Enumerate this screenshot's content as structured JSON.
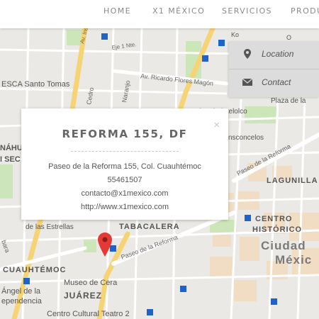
{
  "nav": {
    "items": [
      "HOME",
      "X1 MÉXICO",
      "SERVICIOS",
      "PRODU"
    ]
  },
  "side_panel": {
    "location_label": "Location",
    "contact_label": "Contact",
    "icons": [
      "map-marker-icon",
      "envelope-icon"
    ]
  },
  "popup": {
    "title": "REFORMA 155, DF",
    "close_symbol": "×",
    "address": "Paseo de la Reforma 155, Col. Cuauhtémoc",
    "phone": "55461507",
    "email": "contacto@x1mexico.com",
    "website": "http://www.x1mexico.com"
  },
  "map": {
    "marker_color": "#e53935",
    "labels": {
      "esca": "ESCA Santo Tomas",
      "av_ricardo": "Av. Ricardo Flores Magón",
      "cc_tlatelolco": "Centro Cultural Tlatelolco",
      "plaza": "Plaza de la",
      "buenavista": "nsconcelos",
      "paseo_reforma_ne": "Paseo de la Reforma",
      "lagunilla": "LAGUNILLA",
      "nahu": "NÁHU",
      "sec": "I SEC",
      "estrellas": "de las Estrellas",
      "tabacalera": "TABACALERA",
      "centro_historico_1": "CENTRO",
      "centro_historico_2": "HISTÓRICO",
      "ciudad": "Ciudad",
      "mexico": "Méxic",
      "paseo_reforma_s": "Paseo de la Reforma",
      "cuauhtemoc": "CUAUHTÉMOC",
      "museo": "Museo de Cera",
      "juarez": "JUÁREZ",
      "angel1": "Ángel de la",
      "angel2": "ependencia",
      "teatro": "Centro Cultural Teatro 2",
      "barbara": "bara",
      "naranjo": "Naranjo",
      "cedro": "Cedro",
      "eje1": "Eje 1 Nte.",
      "insurgentes": "Av. Insurgentes",
      "kdlo": "Ko",
      "o1": "O"
    }
  }
}
